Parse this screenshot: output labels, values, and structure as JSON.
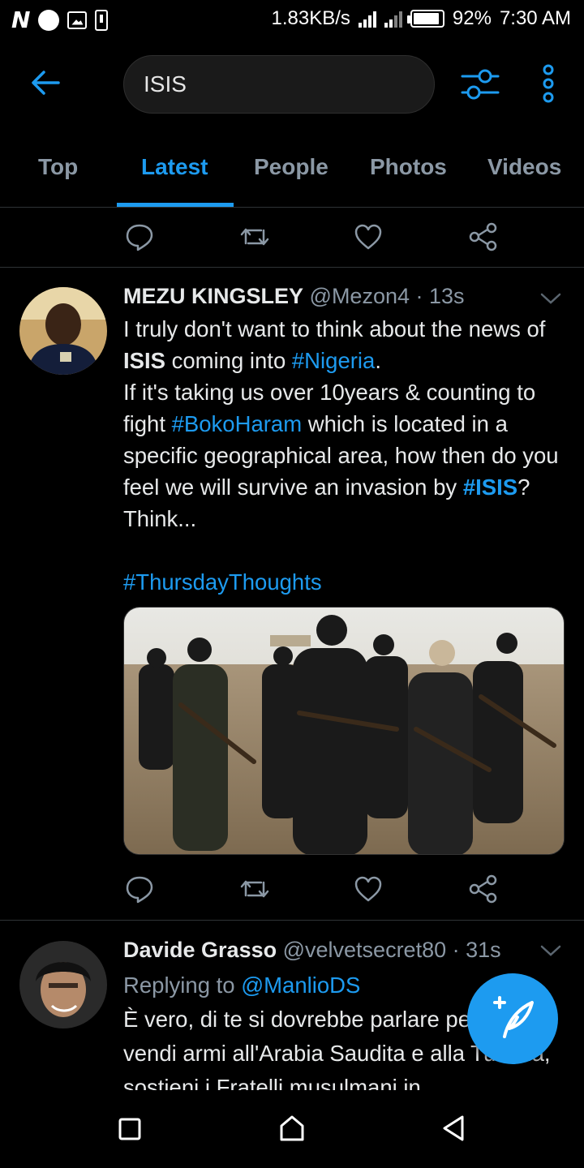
{
  "status_bar": {
    "n_logo": "N",
    "net_speed": "1.83KB/s",
    "battery_pct": "92%",
    "battery_level": 0.92,
    "time": "7:30 AM"
  },
  "search": {
    "query": "ISIS"
  },
  "tabs": [
    {
      "label": "Top"
    },
    {
      "label": "Latest"
    },
    {
      "label": "People"
    },
    {
      "label": "Photos"
    },
    {
      "label": "Videos"
    }
  ],
  "active_tab": "Latest",
  "tweets": [
    {
      "name": "MEZU KINGSLEY",
      "handle": "@Mezon4",
      "time": "· 13s",
      "text_parts": {
        "p1": "I truly don't want to think about the news of ",
        "b1": "ISIS",
        "p2": " coming into ",
        "t1": "#Nigeria",
        "p3": ".",
        "p4": "If it's taking us over 10years & counting to fight ",
        "t2": "#BokoHaram",
        "p5": " which is located in a specific geographical area,  how then do you feel we will survive an invasion by ",
        "t3": "#ISIS",
        "p6": "? Think...",
        "t4": "#ThursdayThoughts"
      }
    },
    {
      "name": "Davide Grasso",
      "handle": "@velvetsecret80",
      "time": "· 31s",
      "replying_to_label": "Replying to",
      "replying_to_handle": "@ManlioDS",
      "text": "È vero, di te si dovrebbe parlare perché vendi armi all'Arabia Saudita e alla Turchia, sostieni i Fratelli musulmani in"
    }
  ],
  "icons": {
    "back": "arrow-left-icon",
    "filter": "sliders-icon",
    "more": "more-vertical-icon",
    "reply": "reply-icon",
    "retweet": "retweet-icon",
    "like": "heart-icon",
    "share": "share-icon",
    "compose": "compose-feather-icon"
  },
  "colors": {
    "accent": "#1d9bf0",
    "background": "#000000",
    "muted": "#8b98a5"
  }
}
